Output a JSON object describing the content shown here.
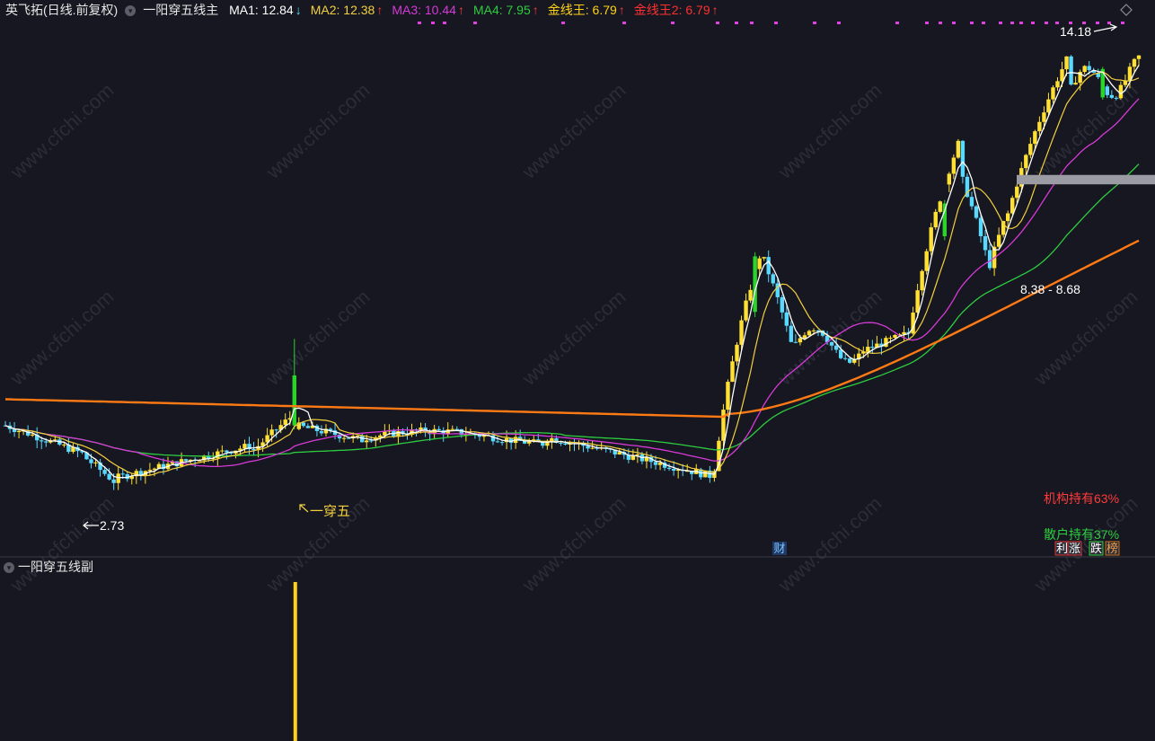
{
  "header": {
    "stock_title": "英飞拓(日线.前复权)",
    "indicator_name": "一阳穿五线主",
    "items": [
      {
        "label": "MA1: 12.84",
        "arrow": "↓",
        "color": "#ffffff",
        "arrow_color": "#4fe0ff"
      },
      {
        "label": "MA2: 12.38",
        "arrow": "↑",
        "color": "#f4d03f",
        "arrow_color": "#ff3b3b"
      },
      {
        "label": "MA3: 10.44",
        "arrow": "↑",
        "color": "#d63ad6",
        "arrow_color": "#ff3b3b"
      },
      {
        "label": "MA4: 7.95",
        "arrow": "↑",
        "color": "#2ecc40",
        "arrow_color": "#ff3b3b"
      },
      {
        "label": "金线王: 6.79",
        "arrow": "↑",
        "color": "#ffd11a",
        "arrow_color": "#ff3b3b"
      },
      {
        "label": "金线王2: 6.79",
        "arrow": "↑",
        "color": "#ff3030",
        "arrow_color": "#ff3b3b"
      }
    ]
  },
  "sub_panel": {
    "title": "一阳穿五线副"
  },
  "annotations": {
    "high_label": "14.18",
    "low_label": "2.73",
    "signal_label": "一穿五",
    "range_label": "8.38 - 8.68",
    "fin_badge": "财",
    "inst_label": "机构持有63%",
    "retail_label": "散户持有37%",
    "badges": [
      "利",
      "涨",
      "跌",
      "榜"
    ],
    "watermark": "www.cfchi.com"
  },
  "colors": {
    "background": "#161720",
    "up": "#ffe033",
    "down": "#59d9ff",
    "strong_up": "#2bd42b",
    "ma1": "#ffffff",
    "ma2": "#f4d03f",
    "ma3": "#d63ad6",
    "ma4": "#2ecc40",
    "gold": "#ff7a14",
    "signal_bar": "#ffd11a"
  },
  "chart_data": {
    "type": "candlestick",
    "price_range": [
      2.3,
      14.6
    ],
    "reference_levels": {
      "high": 14.18,
      "low": 2.73,
      "band": [
        8.38,
        8.68
      ],
      "gold_line": 6.79
    },
    "ma": {
      "MA1": 12.84,
      "MA2": 12.38,
      "MA3": 10.44,
      "MA4": 7.95
    },
    "sub_signal_bars": [
      {
        "bar_index": "一穿五 signal day",
        "value": 1
      }
    ]
  }
}
